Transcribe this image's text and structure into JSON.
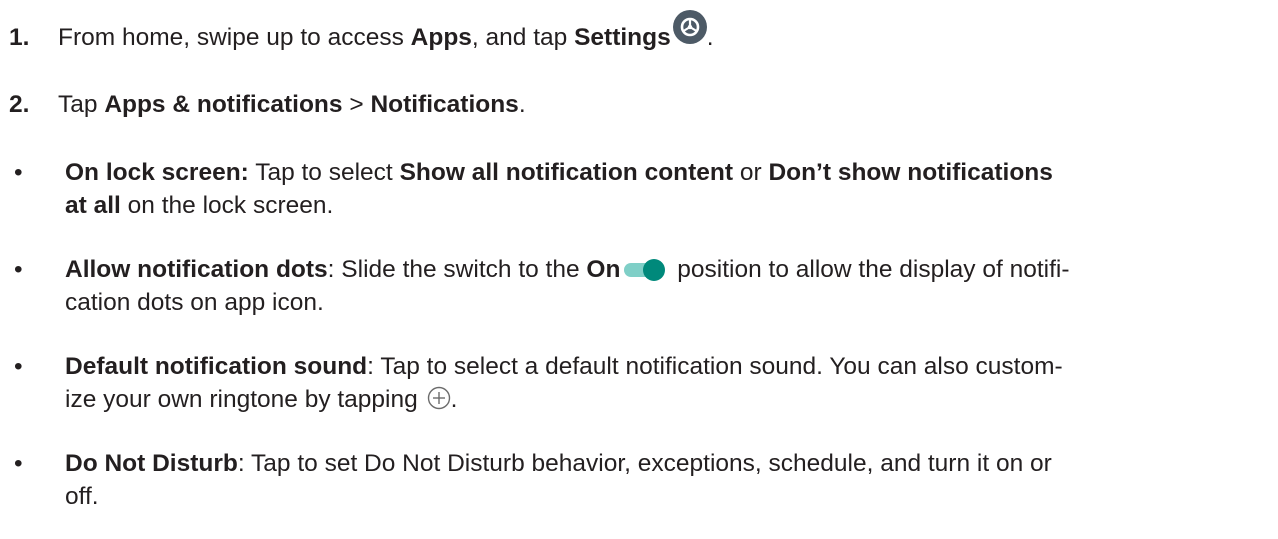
{
  "steps": [
    {
      "number": "1.",
      "pre": "From home, swipe up to access ",
      "b1": "Apps",
      "mid": ", and tap ",
      "b2": "Settings",
      "icon": "settings-icon",
      "post": "."
    },
    {
      "number": "2.",
      "pre": "Tap ",
      "b1": "Apps & notifications",
      "mid": " > ",
      "b2": "Notifications",
      "post": "."
    }
  ],
  "bullets": [
    {
      "marker": "•",
      "line1": {
        "b1": "On lock screen:",
        "t1": " Tap to select ",
        "b2": "Show all notification content",
        "t2": " or ",
        "b3": "Don’t show notifications"
      },
      "line2": {
        "b1": "at all",
        "t1": " on the lock screen."
      }
    },
    {
      "marker": "•",
      "line1": {
        "b1": "Allow notification dots",
        "t1": ": Slide the switch to the ",
        "b2": "On",
        "icon": "toggle-on-icon",
        "t2": " position to allow the display of notifi-"
      },
      "line2": {
        "t1": "cation dots on app icon."
      }
    },
    {
      "marker": "•",
      "line1": {
        "b1": "Default notification sound",
        "t1": ": Tap to select a default notification sound. You can also custom-"
      },
      "line2": {
        "t1": "ize your own ringtone by tapping ",
        "icon": "add-circle-icon",
        "t2": "."
      }
    },
    {
      "marker": "•",
      "line1": {
        "b1": "Do Not Disturb",
        "t1": ": Tap to set Do Not Disturb behavior, exceptions, schedule, and turn it on or"
      },
      "line2": {
        "t1": "off."
      }
    }
  ],
  "colors": {
    "text": "#231f20",
    "settings_icon_bg": "#4d5a66",
    "toggle_track": "#7fcfc7",
    "toggle_knob": "#00897b",
    "add_icon_stroke": "#6b6b6b"
  }
}
